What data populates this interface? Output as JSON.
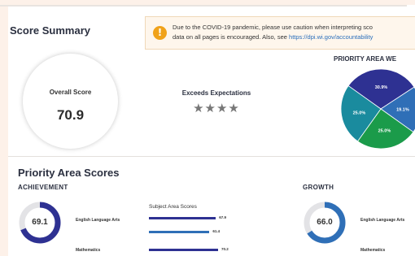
{
  "summary": {
    "title": "Score Summary",
    "alert": {
      "icon": "exclamation-icon",
      "line1": "Due to the COVID-19 pandemic, please use caution when interpreting sco",
      "line2_prefix": "data on all pages is encouraged. Also, see ",
      "link": "https://dpi.wi.gov/accountability"
    },
    "overall_label": "Overall Score",
    "overall_value": "70.9",
    "rating": "Exceeds Expectations",
    "stars_filled": 4,
    "stars_text": "★★★★"
  },
  "priority_pie": {
    "title": "PRIORITY AREA WE",
    "colors": [
      "#2e3192",
      "#2f6fb7",
      "#1b9b4a",
      "#1a8b9e"
    ]
  },
  "chart_data": {
    "type": "pie",
    "title": "PRIORITY AREA WE",
    "slices": [
      {
        "label": "30.9%",
        "value": 30.9
      },
      {
        "label": "19.1%",
        "value": 19.1
      },
      {
        "label": "25.0%",
        "value": 25.0
      },
      {
        "label": "25.0%",
        "value": 25.0
      }
    ]
  },
  "priority_areas": {
    "title": "Priority Area Scores",
    "achievement": {
      "label": "ACHIEVEMENT",
      "score": "69.1",
      "score_fraction": 0.69,
      "subject_1": "English Language Arts",
      "subject_2": "Mathematics",
      "bars_title": "Subject Area Scores",
      "bars": [
        {
          "value": 67.9,
          "label": "67.9",
          "color": "#2e3192"
        },
        {
          "value": 61.4,
          "label": "61.4",
          "color": "#2f6fb7"
        },
        {
          "value": 70.2,
          "label": "70.2",
          "color": "#2e3192"
        }
      ]
    },
    "growth": {
      "label": "GROWTH",
      "score": "66.0",
      "score_fraction": 0.66,
      "subject_1": "English Language Arts",
      "subject_2": "Mathematics"
    }
  }
}
